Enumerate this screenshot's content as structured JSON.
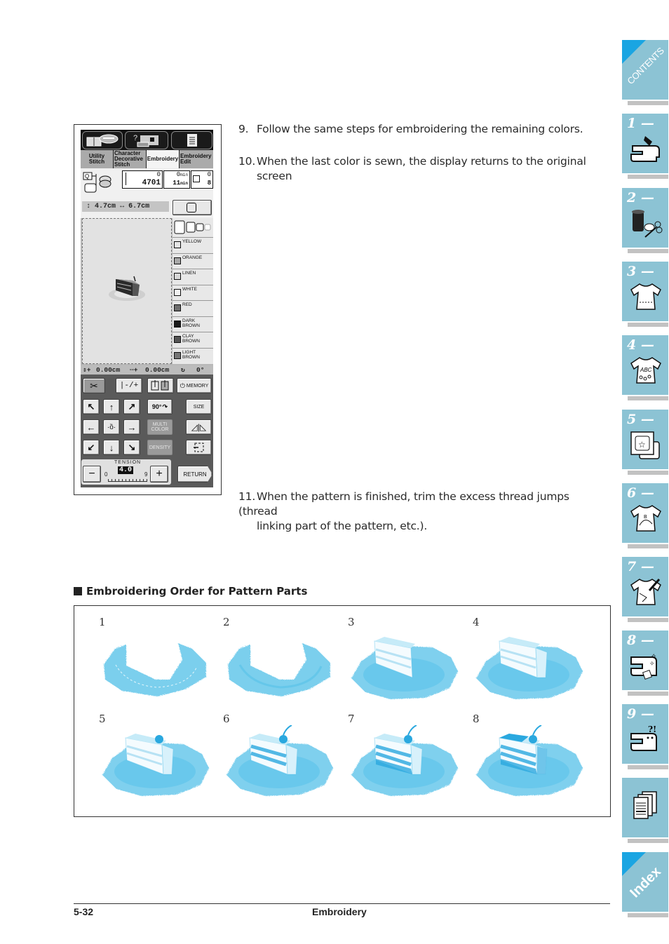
{
  "instructions": [
    {
      "num": "9.",
      "text": "Follow the same steps for embroidering the remaining colors."
    },
    {
      "num": "10.",
      "text": "When the last color is sewn, the display returns to the original",
      "cont": "screen"
    },
    {
      "num": "11.",
      "text": "When the pattern is finished, trim the excess thread jumps (thread",
      "cont": "linking part of the pattern, etc.)."
    }
  ],
  "lcd": {
    "top_icons": [
      "book-icon",
      "help-machine-icon",
      "document-list-icon"
    ],
    "tabs": [
      {
        "label": "Utility\nStitch",
        "active": false
      },
      {
        "label": "Character\nDecorative\nStitch",
        "active": false
      },
      {
        "label": "Embroidery",
        "active": true
      },
      {
        "label": "Embroidery\nEdit",
        "active": false
      }
    ],
    "status": {
      "stitch_current": "0",
      "stitch_total": "4701",
      "time_current": "0",
      "time_current_unit": "min",
      "time_total": "11",
      "time_total_unit": "min",
      "color_current": "0",
      "color_total": "8"
    },
    "size": {
      "height": "4.7cm",
      "width": "6.7cm"
    },
    "image_button": "IMAGE",
    "colors": [
      {
        "name": "YELLOW",
        "swatch": "#e6e6e6"
      },
      {
        "name": "ORANGE",
        "swatch": "#a8a8a8"
      },
      {
        "name": "LINEN",
        "swatch": "#d8d8d8"
      },
      {
        "name": "WHITE",
        "swatch": "#f2f2f2"
      },
      {
        "name": "RED",
        "swatch": "#6e6e6e"
      },
      {
        "name": "DARK\nBROWN",
        "swatch": "#1a1a1a"
      },
      {
        "name": "CLAY\nBROWN",
        "swatch": "#555555"
      },
      {
        "name": "LIGHT\nBROWN",
        "swatch": "#777777"
      }
    ],
    "position": {
      "x": "0.00cm",
      "y": "0.00cm",
      "angle": "0°"
    },
    "buttons": {
      "memory": "MEMORY",
      "rotate": "90°",
      "size": "SIZE",
      "multi_color": "MULTI\nCOLOR",
      "density": "DENSITY",
      "return": "RETURN"
    },
    "tension": {
      "label": "TENSION",
      "min": "0",
      "max": "9",
      "value": "4.0"
    }
  },
  "section": {
    "title": "Embroidering Order for Pattern Parts",
    "steps": [
      "1",
      "2",
      "3",
      "4",
      "5",
      "6",
      "7",
      "8"
    ]
  },
  "side_tabs": [
    {
      "label": "CONTENTS",
      "kind": "contents"
    },
    {
      "label": "1 —",
      "icon": "sewing-machine-hand-icon"
    },
    {
      "label": "2 —",
      "icon": "thread-spool-scissors-icon"
    },
    {
      "label": "3 —",
      "icon": "shirt-dotted-icon"
    },
    {
      "label": "4 —",
      "icon": "shirt-abc-icon"
    },
    {
      "label": "5 —",
      "icon": "embroidery-frame-icon"
    },
    {
      "label": "6 —",
      "icon": "shirt-design-icon"
    },
    {
      "label": "7 —",
      "icon": "shirt-pen-icon"
    },
    {
      "label": "8 —",
      "icon": "machine-maintenance-icon"
    },
    {
      "label": "9 —",
      "icon": "machine-question-icon"
    },
    {
      "label": "",
      "icon": "documents-icon"
    },
    {
      "label": "Index",
      "kind": "index"
    }
  ],
  "footer": {
    "page": "5-32",
    "title": "Embroidery"
  },
  "colors": {
    "tab_blue": "#8cc3d4",
    "corner_blue": "#1aa5e2",
    "embroidery_blue": "#4fbfe8"
  }
}
